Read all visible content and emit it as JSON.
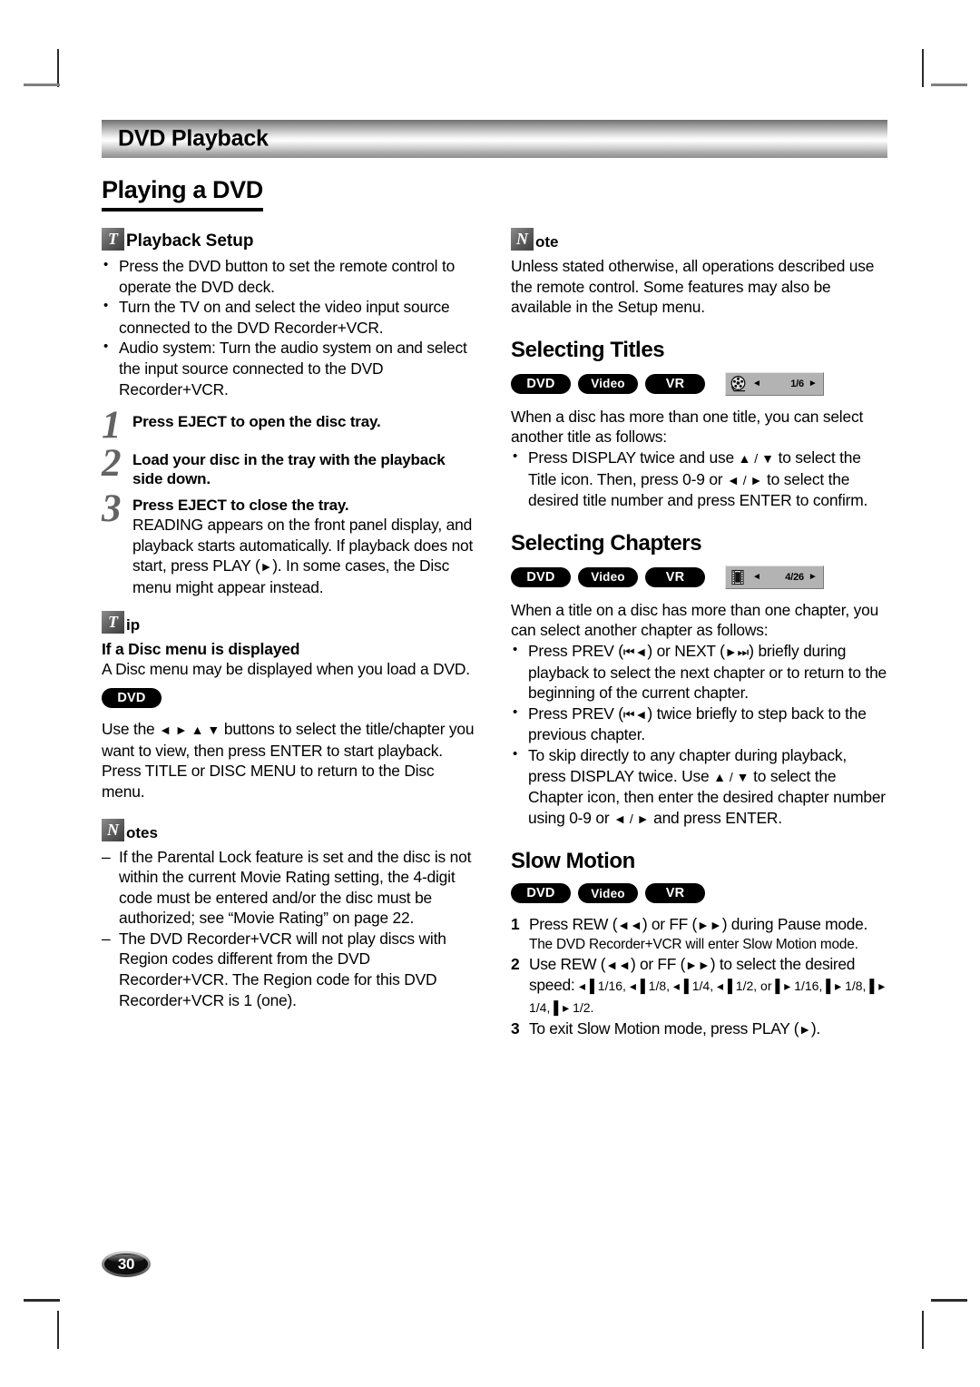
{
  "chapter_header": {
    "title": "DVD Playback"
  },
  "main_title": "Playing a DVD",
  "page_number": "30",
  "icons": {
    "tip_glyph": "T",
    "note_glyph": "N",
    "title_osd": "film-reel-icon",
    "chapter_osd": "film-strip-icon",
    "left_arrow": "◄",
    "right_arrow": "►"
  },
  "left_column": {
    "tip_setup": {
      "glyph": "T",
      "word": "Playback Setup",
      "bullets": [
        "Press the DVD button to set the remote control to operate the DVD deck.",
        "Turn the TV on and select the video input source connected to the DVD Recorder+VCR.",
        "Audio system: Turn the audio system on and select the input source connected to the DVD Recorder+VCR."
      ]
    },
    "steps": [
      {
        "num": "1",
        "head": "Press EJECT to open the disc tray.",
        "body": ""
      },
      {
        "num": "2",
        "head": "Load your disc in the tray with the playback side down.",
        "body": ""
      },
      {
        "num": "3",
        "head": "Press EJECT to close the tray.",
        "body_pre": "READING appears on the front panel display, and playback starts automatically. If playback does not start, press PLAY (",
        "body_glyph": "►",
        "body_post": "). In some cases, the Disc menu might appear instead."
      }
    ],
    "tip_disc_menu": {
      "glyph": "T",
      "word": "ip",
      "heading": "If a Disc menu is displayed",
      "text": "A Disc menu may be displayed when you load a DVD.",
      "pill": "DVD",
      "instruction_pre": "Use the ",
      "instruction_glyphs": "◄ ► ▲ ▼",
      "instruction_post": " buttons to select the title/chapter you want to view, then press ENTER to start playback. Press TITLE or DISC MENU to return to the Disc menu."
    },
    "notes": {
      "glyph": "N",
      "word": "otes",
      "items": [
        "If the Parental Lock feature is set and the disc is not within the current Movie Rating setting, the 4-digit code must be entered and/or the disc must be authorized; see “Movie Rating” on page 22.",
        "The DVD Recorder+VCR will not play discs with Region codes different from the DVD Recorder+VCR. The Region code for this DVD Recorder+VCR is 1 (one)."
      ]
    }
  },
  "right_column": {
    "note": {
      "glyph": "N",
      "word": "ote",
      "text": "Unless stated otherwise, all operations described use the remote control. Some features may also be available in the Setup menu."
    },
    "selecting_titles": {
      "heading": "Selecting Titles",
      "pills": [
        "DVD",
        "Video",
        "VR"
      ],
      "osd_value": "1/6",
      "intro": "When a disc has more than one title, you can select another title as follows:",
      "bullet_parts": {
        "p1": "Press DISPLAY twice and use ",
        "g1": "▲ / ▼",
        "p2": " to select the Title icon. Then, press 0-9 or ",
        "g2": "◄ / ►",
        "p3": " to select the desired title number and press ENTER to confirm."
      }
    },
    "selecting_chapters": {
      "heading": "Selecting Chapters",
      "pills": [
        "DVD",
        "Video",
        "VR"
      ],
      "osd_value": "4/26",
      "intro": "When a title on a disc has more than one chapter, you can select another chapter as follows:",
      "bullets": [
        {
          "p1": "Press PREV (",
          "g1": "⏮◄",
          "p2": ") or NEXT (",
          "g2": "►⏭",
          "p3": ") briefly during playback to select the next chapter or to return to the beginning of the current chapter."
        },
        {
          "p1": "Press PREV (",
          "g1": "⏮◄",
          "p2": ") twice briefly to step back to the previous chapter.",
          "g2": "",
          "p3": ""
        },
        {
          "p1": "To skip directly to any chapter during playback, press DISPLAY twice. Use ",
          "g1": "▲ / ▼",
          "p2": " to select the Chapter icon, then enter the desired chapter number using 0-9 or ",
          "g2": "◄ / ►",
          "p3": " and press ENTER."
        }
      ]
    },
    "slow_motion": {
      "heading": "Slow Motion",
      "pills": [
        "DVD",
        "Video",
        "VR"
      ],
      "step1": {
        "num": "1",
        "p1": "Press REW (",
        "g1": "◄◄",
        "p2": ") or FF (",
        "g2": "►►",
        "p3": ") during Pause mode.",
        "sub": "The DVD Recorder+VCR will enter Slow Motion mode."
      },
      "step2": {
        "num": "2",
        "p1": "Use REW (",
        "g1": "◄◄",
        "p2": ") or FF (",
        "g2": "►►",
        "p3": ") to select the desired speed:  ",
        "speeds": "◂▐ 1/16, ◂▐ 1/8, ◂▐ 1/4, ◂▐ 1/2, or ▌▸ 1/16, ▌▸ 1/8, ▌▸ 1/4, ▌▸ 1/2."
      },
      "step3": {
        "num": "3",
        "p1": "To exit Slow Motion mode, press PLAY (",
        "g1": "►",
        "p2": ")."
      }
    }
  }
}
